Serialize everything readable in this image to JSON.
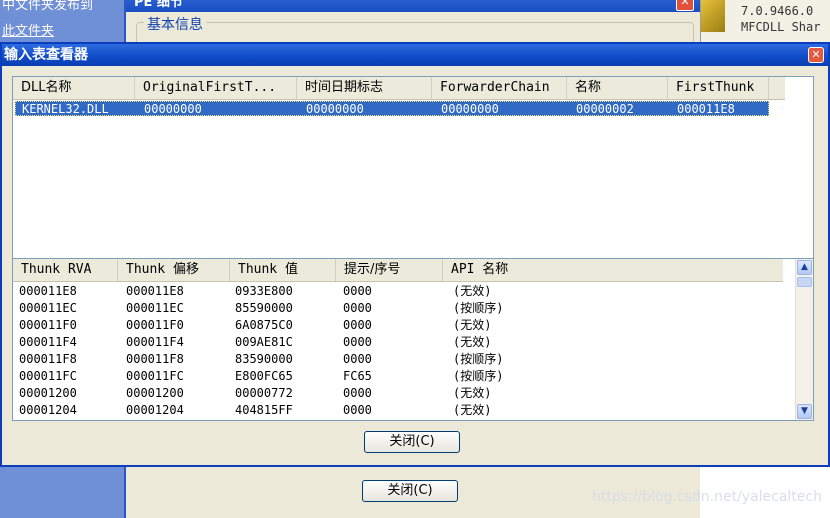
{
  "background": {
    "left_panel": {
      "line1": "中文件夹发布到",
      "line2": "此文件夹"
    },
    "pe_window": {
      "title": "PE 细节",
      "group_label": "基本信息",
      "close_label": "✕"
    },
    "right_panel": {
      "line1": "7.0.9466.0",
      "line2": "MFCDLL Shar"
    },
    "close_button_label": "关闭(C)",
    "watermark": "https://blog.csdn.net/yalecaltech"
  },
  "dialog": {
    "title": "输入表查看器",
    "close_label": "✕",
    "import_table": {
      "columns": [
        "DLL名称",
        "OriginalFirstT...",
        "时间日期标志",
        "ForwarderChain",
        "名称",
        "FirstThunk"
      ],
      "rows": [
        [
          "KERNEL32.DLL",
          "00000000",
          "00000000",
          "00000000",
          "00000002",
          "000011E8"
        ]
      ]
    },
    "thunk_table": {
      "columns": [
        "Thunk RVA",
        "Thunk 偏移",
        "Thunk 值",
        "提示/序号",
        "API 名称"
      ],
      "rows": [
        [
          "000011E8",
          "000011E8",
          "0933E800",
          "0000",
          "(无效)"
        ],
        [
          "000011EC",
          "000011EC",
          "85590000",
          "0000",
          "(按顺序)"
        ],
        [
          "000011F0",
          "000011F0",
          "6A0875C0",
          "0000",
          "(无效)"
        ],
        [
          "000011F4",
          "000011F4",
          "009AE81C",
          "0000",
          "(无效)"
        ],
        [
          "000011F8",
          "000011F8",
          "83590000",
          "0000",
          "(按顺序)"
        ],
        [
          "000011FC",
          "000011FC",
          "E800FC65",
          "FC65",
          "(按顺序)"
        ],
        [
          "00001200",
          "00001200",
          "00000772",
          "0000",
          "(无效)"
        ],
        [
          "00001204",
          "00001204",
          "404815FF",
          "0000",
          "(无效)"
        ]
      ]
    },
    "close_button_label": "关闭(C)"
  }
}
